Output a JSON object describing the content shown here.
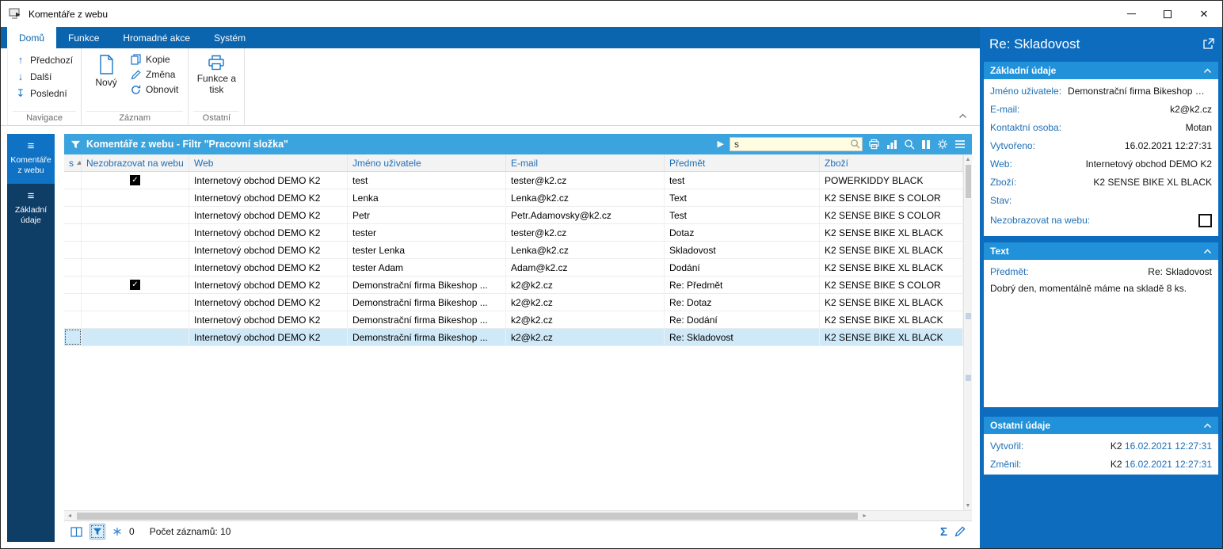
{
  "colors": {
    "ribbon_blue": "#0a64ae",
    "sidebar_navy": "#0e3d66",
    "sidebar_active": "#0f72c4",
    "bar_blue": "#3ba4de",
    "panel_blue": "#0d6cbe",
    "sec_head_blue": "#2191da",
    "label_blue": "#1f6fb5",
    "icon_blue": "#1c76c8",
    "sel_row": "#cfe9f8",
    "search_bg": "#fffde1"
  },
  "window": {
    "title": "Komentáře z webu"
  },
  "ribbon": {
    "tabs": [
      {
        "label": "Domů",
        "active": true
      },
      {
        "label": "Funkce",
        "active": false
      },
      {
        "label": "Hromadné akce",
        "active": false
      },
      {
        "label": "Systém",
        "active": false
      }
    ],
    "navigace": {
      "label": "Navigace",
      "items": [
        "Předchozí",
        "Další",
        "Poslední"
      ]
    },
    "zaznam": {
      "label": "Záznam",
      "new_label": "Nový",
      "items": [
        "Kopie",
        "Změna",
        "Obnovit"
      ]
    },
    "ostatni": {
      "label": "Ostatní",
      "button": "Funkce a tisk"
    }
  },
  "sidebar": {
    "items": [
      {
        "label": "Komentáře z webu",
        "active": true
      },
      {
        "label": "Základní údaje",
        "active": false
      }
    ]
  },
  "grid": {
    "title": "Komentáře z webu - Filtr \"Pracovní složka\"",
    "search_value": "s",
    "columns": [
      "s",
      "Nezobrazovat na webu",
      "Web",
      "Jméno uživatele",
      "E-mail",
      "Předmět",
      "Zboží"
    ],
    "rows": [
      {
        "checked": true,
        "selected": false,
        "web": "Internetový obchod DEMO K2",
        "user": "test",
        "email": "tester@k2.cz",
        "subject": "test",
        "goods": "POWERKIDDY BLACK"
      },
      {
        "checked": false,
        "selected": false,
        "web": "Internetový obchod DEMO K2",
        "user": "Lenka",
        "email": "Lenka@k2.cz",
        "subject": "Text",
        "goods": "K2 SENSE BIKE S COLOR"
      },
      {
        "checked": false,
        "selected": false,
        "web": "Internetový obchod DEMO K2",
        "user": "Petr",
        "email": "Petr.Adamovsky@k2.cz",
        "subject": "Test",
        "goods": "K2 SENSE BIKE S COLOR"
      },
      {
        "checked": false,
        "selected": false,
        "web": "Internetový obchod DEMO K2",
        "user": "tester",
        "email": "tester@k2.cz",
        "subject": "Dotaz",
        "goods": "K2 SENSE BIKE XL BLACK"
      },
      {
        "checked": false,
        "selected": false,
        "web": "Internetový obchod DEMO K2",
        "user": "tester Lenka",
        "email": "Lenka@k2.cz",
        "subject": "Skladovost",
        "goods": "K2 SENSE BIKE XL BLACK"
      },
      {
        "checked": false,
        "selected": false,
        "web": "Internetový obchod DEMO K2",
        "user": "tester Adam",
        "email": "Adam@k2.cz",
        "subject": "Dodání",
        "goods": "K2 SENSE BIKE XL BLACK"
      },
      {
        "checked": true,
        "selected": false,
        "web": "Internetový obchod DEMO K2",
        "user": "Demonstrační firma Bikeshop ...",
        "email": "k2@k2.cz",
        "subject": "Re: Předmět",
        "goods": "K2 SENSE BIKE S COLOR"
      },
      {
        "checked": false,
        "selected": false,
        "web": "Internetový obchod DEMO K2",
        "user": "Demonstrační firma Bikeshop ...",
        "email": "k2@k2.cz",
        "subject": "Re: Dotaz",
        "goods": "K2 SENSE BIKE XL BLACK"
      },
      {
        "checked": false,
        "selected": false,
        "web": "Internetový obchod DEMO K2",
        "user": "Demonstrační firma Bikeshop ...",
        "email": "k2@k2.cz",
        "subject": "Re: Dodání",
        "goods": "K2 SENSE BIKE XL BLACK"
      },
      {
        "checked": false,
        "selected": true,
        "web": "Internetový obchod DEMO K2",
        "user": "Demonstrační firma Bikeshop ...",
        "email": "k2@k2.cz",
        "subject": "Re: Skladovost",
        "goods": "K2 SENSE BIKE XL BLACK"
      }
    ],
    "status": {
      "badge": "0",
      "count": "Počet záznamů: 10"
    }
  },
  "panel": {
    "title": "Re: Skladovost",
    "zakladni": {
      "title": "Základní údaje",
      "rows": [
        {
          "label": "Jméno uživatele:",
          "value": "Demonstrační firma Bikeshop Ostr..."
        },
        {
          "label": "E-mail:",
          "value": "k2@k2.cz"
        },
        {
          "label": "Kontaktní osoba:",
          "value": "Motan"
        },
        {
          "label": "Vytvořeno:",
          "value": "16.02.2021 12:27:31"
        },
        {
          "label": "Web:",
          "value": "Internetový obchod DEMO K2"
        },
        {
          "label": "Zboží:",
          "value": "K2 SENSE BIKE XL BLACK"
        },
        {
          "label": "Stav:",
          "value": ""
        }
      ],
      "checkbox_label": "Nezobrazovat na webu:",
      "checkbox_checked": false
    },
    "text": {
      "title": "Text",
      "predmet_label": "Předmět:",
      "predmet_value": "Re: Skladovost",
      "body": "Dobrý den, momentálně máme na skladě 8 ks."
    },
    "ostatni": {
      "title": "Ostatní údaje",
      "rows": [
        {
          "label": "Vytvořil:",
          "user": "K2",
          "datetime": "16.02.2021 12:27:31"
        },
        {
          "label": "Změnil:",
          "user": "K2",
          "datetime": "16.02.2021 12:27:31"
        }
      ]
    }
  }
}
